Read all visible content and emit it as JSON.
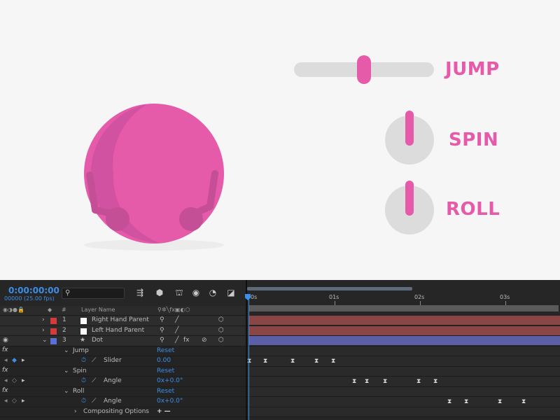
{
  "controls": {
    "jump_label": "JUMP",
    "spin_label": "SPIN",
    "roll_label": "ROLL",
    "jump_slider_value": 0.5,
    "accent_color": "#e55aa9",
    "track_color": "#dcdcdc"
  },
  "timeline": {
    "timecode": "0:00:00:00",
    "frame_info": "00000 (25.00 fps)",
    "toolbar_icons": [
      "search-icon",
      "comp-flowchart-icon",
      "draft-3d-icon",
      "frame-blending-icon",
      "motion-blur-icon",
      "graph-editor-icon"
    ],
    "column_header": {
      "num": "#",
      "layer_name": "Layer Name"
    },
    "layers": [
      {
        "num": "1",
        "name": "Right Hand Parent",
        "color": "#d83a3a"
      },
      {
        "num": "2",
        "name": "Left Hand Parent",
        "color": "#d83a3a"
      },
      {
        "num": "3",
        "name": "Dot",
        "color": "#5c6ed8"
      }
    ],
    "effects": [
      {
        "name": "Jump",
        "reset": "Reset",
        "prop": "Slider",
        "value": "0.00"
      },
      {
        "name": "Spin",
        "reset": "Reset",
        "prop": "Angle",
        "value": "0x+0.0°"
      },
      {
        "name": "Roll",
        "reset": "Reset",
        "prop": "Angle",
        "value": "0x+0.0°"
      }
    ],
    "fx_label": "fx",
    "compositing_options": "Compositing Options",
    "compositing_buttons": "+ —",
    "ruler": [
      "0s",
      "01s",
      "02s",
      "03s"
    ]
  }
}
